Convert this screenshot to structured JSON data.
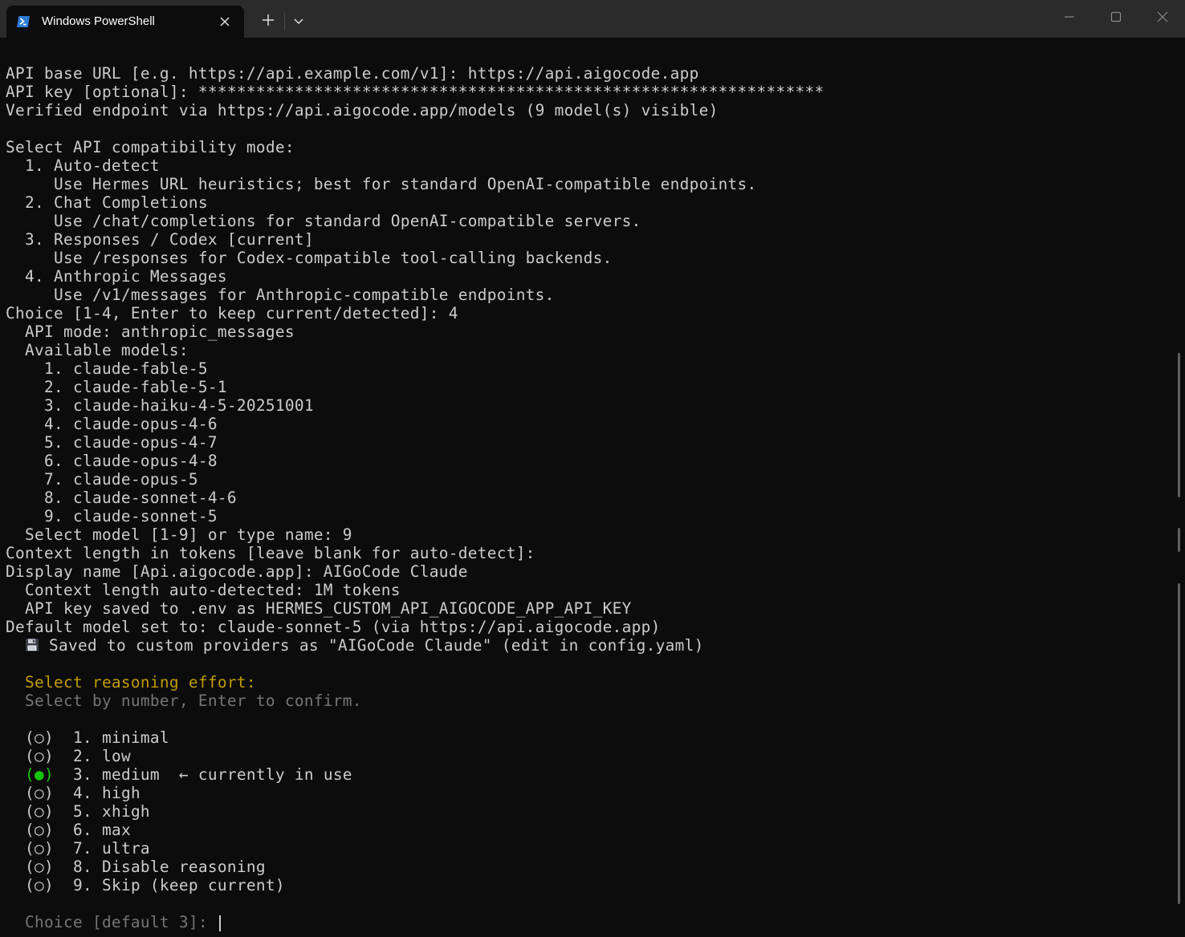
{
  "window": {
    "tab_title": "Windows PowerShell",
    "new_tab_symbol": "+",
    "icons": {
      "tab": "powershell-icon",
      "close_tab": "close-icon",
      "new_tab": "plus-icon",
      "dropdown": "chevron-down-icon",
      "minimize": "minimize-icon",
      "maximize": "maximize-icon",
      "close_window": "close-icon"
    }
  },
  "terminal": {
    "setup": {
      "base_url": "API base URL [e.g. https://api.example.com/v1]: https://api.aigocode.app",
      "api_key": "API key [optional]: *****************************************************************",
      "verified": "Verified endpoint via https://api.aigocode.app/models (9 model(s) visible)"
    },
    "compat": {
      "header": "Select API compatibility mode:",
      "options": [
        {
          "title": "  1. Auto-detect",
          "desc": "     Use Hermes URL heuristics; best for standard OpenAI-compatible endpoints."
        },
        {
          "title": "  2. Chat Completions",
          "desc": "     Use /chat/completions for standard OpenAI-compatible servers."
        },
        {
          "title": "  3. Responses / Codex [current]",
          "desc": "     Use /responses for Codex-compatible tool-calling backends."
        },
        {
          "title": "  4. Anthropic Messages",
          "desc": "     Use /v1/messages for Anthropic-compatible endpoints."
        }
      ],
      "choice": "Choice [1-4, Enter to keep current/detected]: 4",
      "api_mode": "  API mode: anthropic_messages"
    },
    "models": {
      "header": "  Available models:",
      "items": [
        "    1. claude-fable-5",
        "    2. claude-fable-5-1",
        "    3. claude-haiku-4-5-20251001",
        "    4. claude-opus-4-6",
        "    5. claude-opus-4-7",
        "    6. claude-opus-4-8",
        "    7. claude-opus-5",
        "    8. claude-sonnet-4-6",
        "    9. claude-sonnet-5"
      ],
      "select": "  Select model [1-9] or type name: 9"
    },
    "config": {
      "context_prompt": "Context length in tokens [leave blank for auto-detect]:",
      "display_name": "Display name [Api.aigocode.app]: AIGoCode Claude",
      "context_detected": "  Context length auto-detected: 1M tokens",
      "key_saved": "  API key saved to .env as HERMES_CUSTOM_API_AIGOCODE_APP_API_KEY",
      "default_model": "Default model set to: claude-sonnet-5 (via https://api.aigocode.app)",
      "saved_indent": "  ",
      "saved_icon": "floppy-disk-icon",
      "saved_text": " Saved to custom providers as \"AIGoCode Claude\" (edit in config.yaml)"
    },
    "reasoning": {
      "title": "  Select reasoning effort:",
      "subtitle": "  Select by number, Enter to confirm.",
      "selected_radio": "(●)",
      "options": [
        {
          "radio": "  (○)",
          "label": "  1. minimal",
          "suffix": ""
        },
        {
          "radio": "  (○)",
          "label": "  2. low",
          "suffix": ""
        },
        {
          "radio": "  ",
          "label": "  3. medium",
          "suffix": "  ← currently in use"
        },
        {
          "radio": "  (○)",
          "label": "  4. high",
          "suffix": ""
        },
        {
          "radio": "  (○)",
          "label": "  5. xhigh",
          "suffix": ""
        },
        {
          "radio": "  (○)",
          "label": "  6. max",
          "suffix": ""
        },
        {
          "radio": "  (○)",
          "label": "  7. ultra",
          "suffix": ""
        },
        {
          "radio": "  (○)",
          "label": "  8. Disable reasoning",
          "suffix": ""
        },
        {
          "radio": "  (○)",
          "label": "  9. Skip (keep current)",
          "suffix": ""
        }
      ],
      "prompt": "  Choice [default 3]: "
    }
  },
  "colors": {
    "background": "#0c0c0c",
    "titlebar": "#2b2b2b",
    "text": "#cccccc",
    "heading_yellow": "#c19c00",
    "dim_gray": "#767676",
    "selected_green": "#16c60c"
  }
}
